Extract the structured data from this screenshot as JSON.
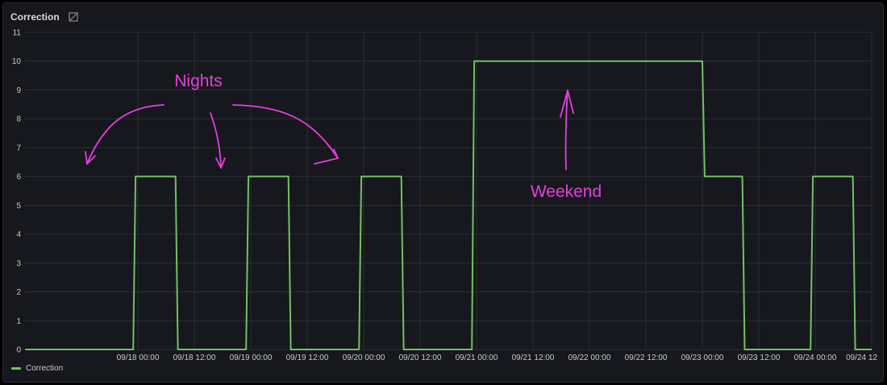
{
  "panel": {
    "title": "Correction"
  },
  "legend": {
    "label": "Correction",
    "color": "#73bf69"
  },
  "annotations": {
    "nights": "Nights",
    "weekend": "Weekend",
    "color": "#e43ee0"
  },
  "chart_data": {
    "type": "line",
    "title": "Correction",
    "xlabel": "",
    "ylabel": "",
    "ylim": [
      0,
      11
    ],
    "yticks": [
      0,
      1,
      2,
      3,
      4,
      5,
      6,
      7,
      8,
      9,
      10,
      11
    ],
    "xlim": [
      "09/17 00:00",
      "09/24 12:00"
    ],
    "xticks": [
      "09/18 00:00",
      "09/18 12:00",
      "09/19 00:00",
      "09/19 12:00",
      "09/20 00:00",
      "09/20 12:00",
      "09/21 00:00",
      "09/21 12:00",
      "09/22 00:00",
      "09/22 12:00",
      "09/23 00:00",
      "09/23 12:00",
      "09/24 00:00",
      "09/24 12"
    ],
    "grid": true,
    "legend_position": "bottom-left",
    "series": [
      {
        "name": "Correction",
        "color": "#73bf69",
        "x": [
          "09/17 00:00",
          "09/17 23:00",
          "09/17 23:30",
          "09/18 08:00",
          "09/18 08:30",
          "09/18 23:00",
          "09/18 23:30",
          "09/19 08:00",
          "09/19 08:30",
          "09/19 23:00",
          "09/19 23:30",
          "09/20 08:00",
          "09/20 08:30",
          "09/20 23:00",
          "09/20 23:30",
          "09/23 00:00",
          "09/23 00:30",
          "09/23 08:30",
          "09/23 09:00",
          "09/23 23:00",
          "09/23 23:30",
          "09/24 08:00",
          "09/24 08:30",
          "09/24 12:00"
        ],
        "y": [
          0,
          0,
          6,
          6,
          0,
          0,
          6,
          6,
          0,
          0,
          6,
          6,
          0,
          0,
          10,
          10,
          6,
          6,
          0,
          0,
          6,
          6,
          0,
          0
        ]
      }
    ]
  }
}
